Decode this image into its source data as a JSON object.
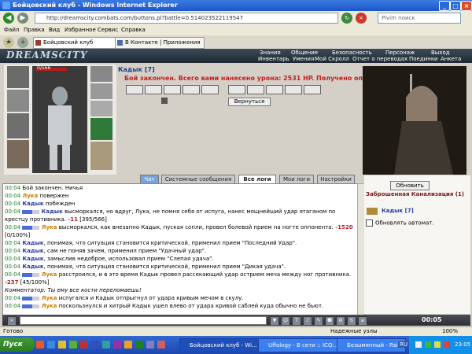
{
  "window": {
    "title": "Бойцовский клуб - Windows Internet Explorer"
  },
  "address": {
    "url": "http://dreamscity.combats.com/buttons.pl?battle=0.514023522119547",
    "search_placeholder": "Pivim поиск"
  },
  "menu": [
    "Файл",
    "Правка",
    "Вид",
    "Избранное",
    "Сервис",
    "Справка"
  ],
  "browser_tabs": [
    {
      "label": "Бойцовский клуб"
    },
    {
      "label": "В Контакте | Приложения"
    }
  ],
  "game": {
    "logo": "DREAMSCITY",
    "nav_top": [
      "Знания",
      "Общение",
      "Безопасность",
      "Персонаж",
      "Выход"
    ],
    "nav_bottom": [
      "Инвентарь",
      "Умения",
      "Мой Скролл",
      "Отчет о переводах",
      "Поединки",
      "Анкета"
    ],
    "char_hp": "0/566",
    "nick": "Кадык [7]",
    "battle_message": "Бой закончен. Всего вами нанесено урона: 2531 HP. Получено опыта: 0.",
    "return_button": "Вернуться"
  },
  "log_tabs": [
    "Чат",
    "Системные сообщения",
    "Все логи",
    "Мои логи",
    "Настройки"
  ],
  "log": [
    {
      "time": "00:04",
      "text": "Бой закончен. Ничья"
    },
    {
      "time": "00:04",
      "name": "Лука",
      "nameclass": "pn",
      "text": " повержен"
    },
    {
      "time": "00:04",
      "name": "Кадык",
      "nameclass": "pk",
      "text": " побежден"
    },
    {
      "time": "00:04",
      "bar": true,
      "name": "Кадык",
      "nameclass": "pk",
      "text": " высморкался, но вдруг, Лука, не помня себя от испуга, нанес мощнейший удар ятаганом по крестцу противника.",
      "dmg": "-11",
      "after": " [395/566]"
    },
    {
      "time": "00:04",
      "bar": true,
      "name": "Лука",
      "nameclass": "pn",
      "text": " высморкался, как внезапно Кадык, пуская сопли, провел болевой прием на ногте оппонента.",
      "dmg": "-1520",
      "after": " [0/100%]"
    },
    {
      "time": "00:04",
      "name": "Кадык",
      "nameclass": "pk",
      "text": ", понимая, что ситуация становится критической, применил прием \"Последний Удар\"."
    },
    {
      "time": "00:04",
      "name": "Кадык",
      "nameclass": "pk",
      "text": ", сам не поняв зачем, применил прием \"Удачный удар\"."
    },
    {
      "time": "00:04",
      "name": "Кадык",
      "nameclass": "pk",
      "text": ", замыслив недоброе, использовал прием \"Слепая удача\"."
    },
    {
      "time": "00:04",
      "name": "Кадык",
      "nameclass": "pk",
      "text": ", понимая, что ситуация становится критической, применил прием \"Дикая удача\"."
    },
    {
      "time": "00:04",
      "bar": true,
      "name": "Лука",
      "nameclass": "pn",
      "text": " расстроился, и в это время Кадык провел рассекающий удар острием меча между ног противника.",
      "dmg": "-237",
      "after": " [45/100%]"
    },
    {
      "comment": "Комментатор: Ты ему все кости переломаешь!"
    },
    {
      "time": "00:04",
      "bar": true,
      "name": "Лука",
      "nameclass": "pn",
      "text": " испугался и Кадык отпрыгнул от удара кривым мечом в скулу."
    },
    {
      "time": "00:04",
      "bar": true,
      "name": "Лука",
      "nameclass": "pn",
      "text": " поскользнулся и хитрый Кадык ушел влево от удара кривой саблей куда обычно не бьют."
    }
  ],
  "online": {
    "refresh_button": "Обновить",
    "location": "Заброшенная Канализация (1)",
    "user": "Кадык [7]",
    "auto_refresh": "Обновлять автомат."
  },
  "chat": {
    "clock": "00:05"
  },
  "status": {
    "left": "Готово",
    "zone": "Надежные узлы",
    "zoom": "100%"
  },
  "taskbar": {
    "start": "Пуск",
    "tasks": [
      "Бойцовский клуб - Wi...",
      "Uffology - В сети :: ICQ:...",
      "Безымянный - Paint"
    ],
    "lang": "RU",
    "time": "23:05"
  },
  "colors": {
    "accent": "#c81c1c",
    "nick_blue": "#2b3ca0",
    "nick_orange": "#c87e00"
  }
}
